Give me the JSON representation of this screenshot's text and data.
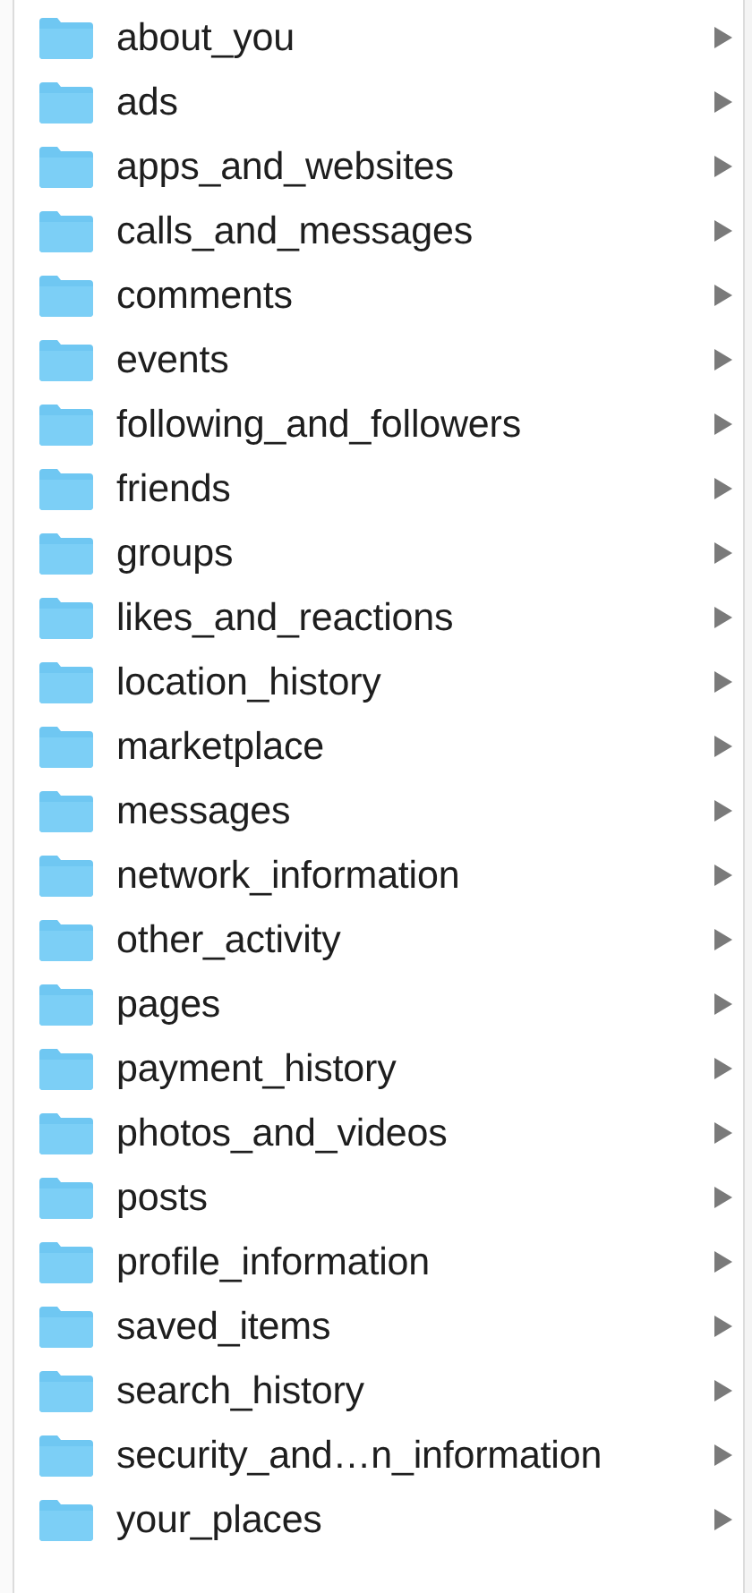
{
  "folders": [
    {
      "name": "about_you"
    },
    {
      "name": "ads"
    },
    {
      "name": "apps_and_websites"
    },
    {
      "name": "calls_and_messages"
    },
    {
      "name": "comments"
    },
    {
      "name": "events"
    },
    {
      "name": "following_and_followers"
    },
    {
      "name": "friends"
    },
    {
      "name": "groups"
    },
    {
      "name": "likes_and_reactions"
    },
    {
      "name": "location_history"
    },
    {
      "name": "marketplace"
    },
    {
      "name": "messages"
    },
    {
      "name": "network_information"
    },
    {
      "name": "other_activity"
    },
    {
      "name": "pages"
    },
    {
      "name": "payment_history"
    },
    {
      "name": "photos_and_videos"
    },
    {
      "name": "posts"
    },
    {
      "name": "profile_information"
    },
    {
      "name": "saved_items"
    },
    {
      "name": "search_history"
    },
    {
      "name": "security_and…n_information"
    },
    {
      "name": "your_places"
    }
  ]
}
